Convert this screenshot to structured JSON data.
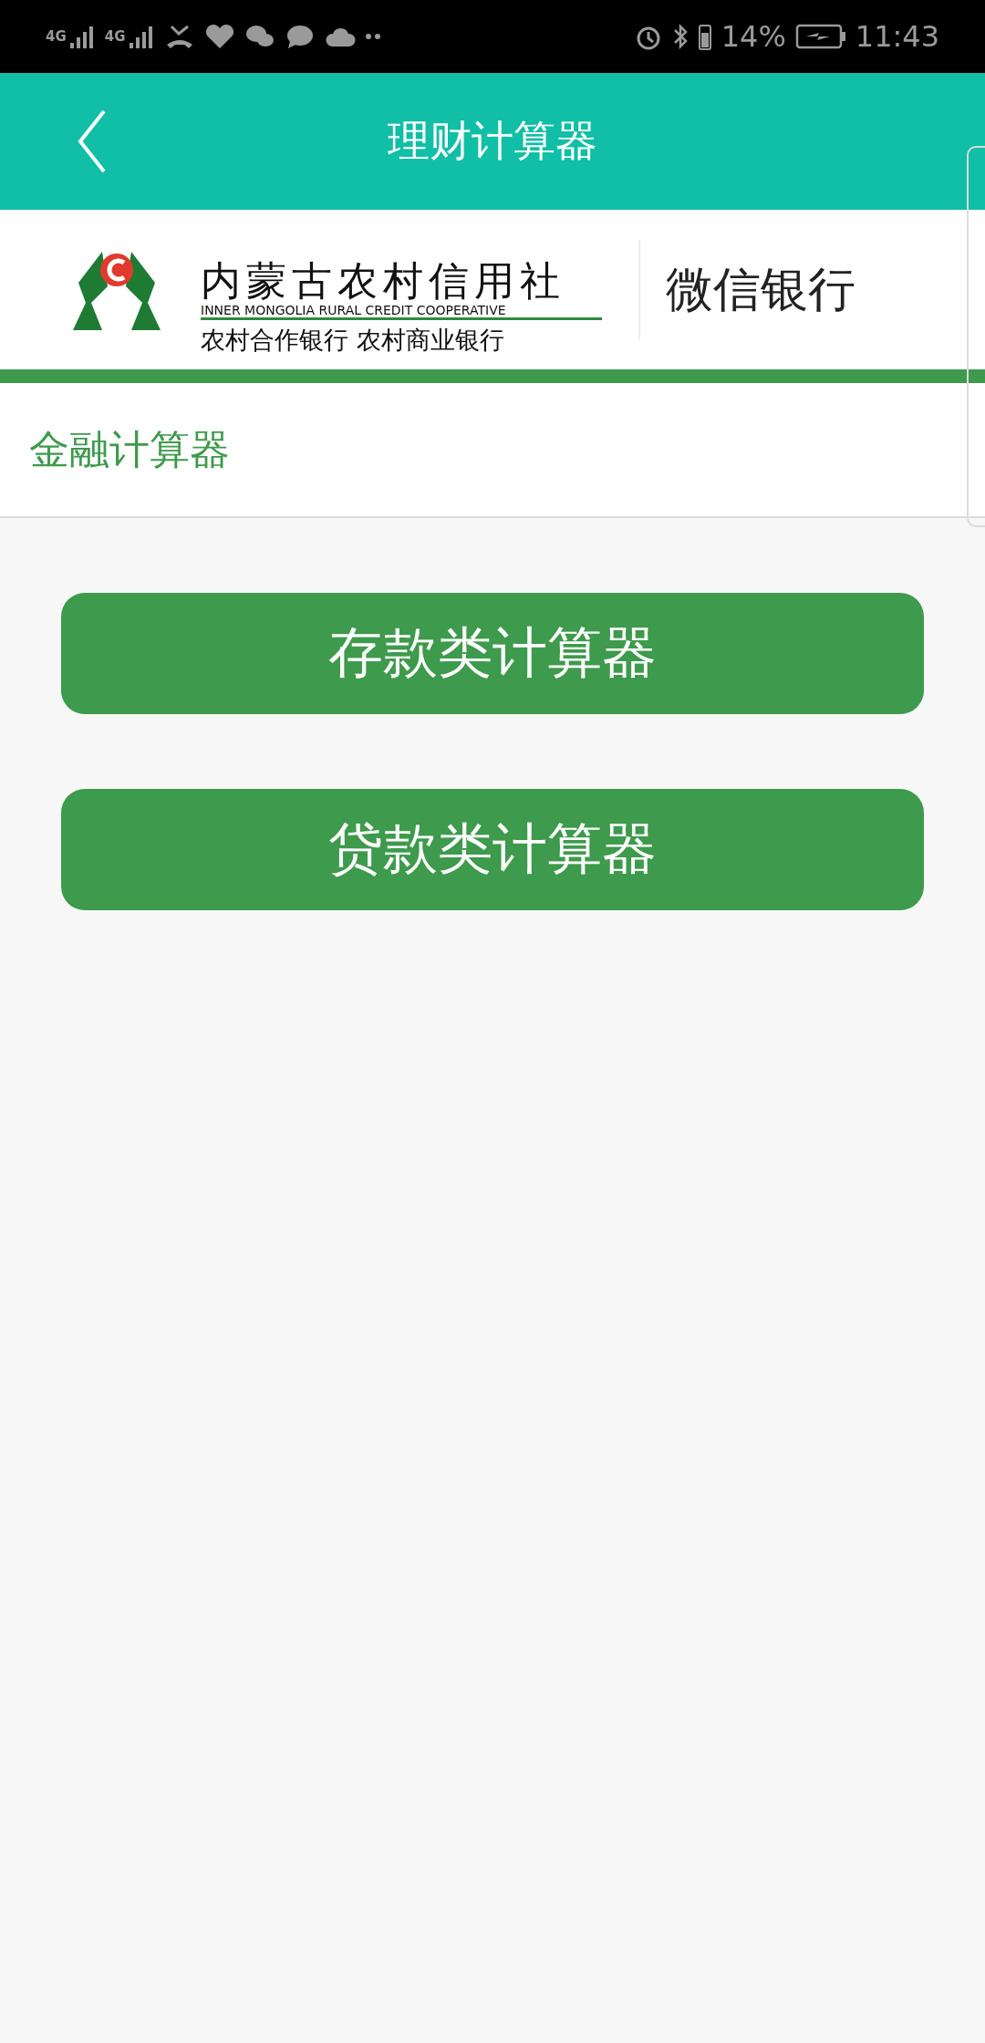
{
  "status_bar": {
    "signals": [
      {
        "label": "4G"
      },
      {
        "label": "4G"
      }
    ],
    "battery_text": "14%",
    "time": "11:43"
  },
  "header": {
    "title": "理财计算器"
  },
  "banner": {
    "org_name": "内蒙古农村信用社",
    "org_english": "INNER  MONGOLIA RURAL CREDIT COOPERATIVE",
    "org_tagline": "农村合作银行  农村商业银行",
    "channel": "微信银行"
  },
  "section": {
    "title": "金融计算器"
  },
  "buttons": [
    {
      "label": "存款类计算器"
    },
    {
      "label": "贷款类计算器"
    }
  ]
}
